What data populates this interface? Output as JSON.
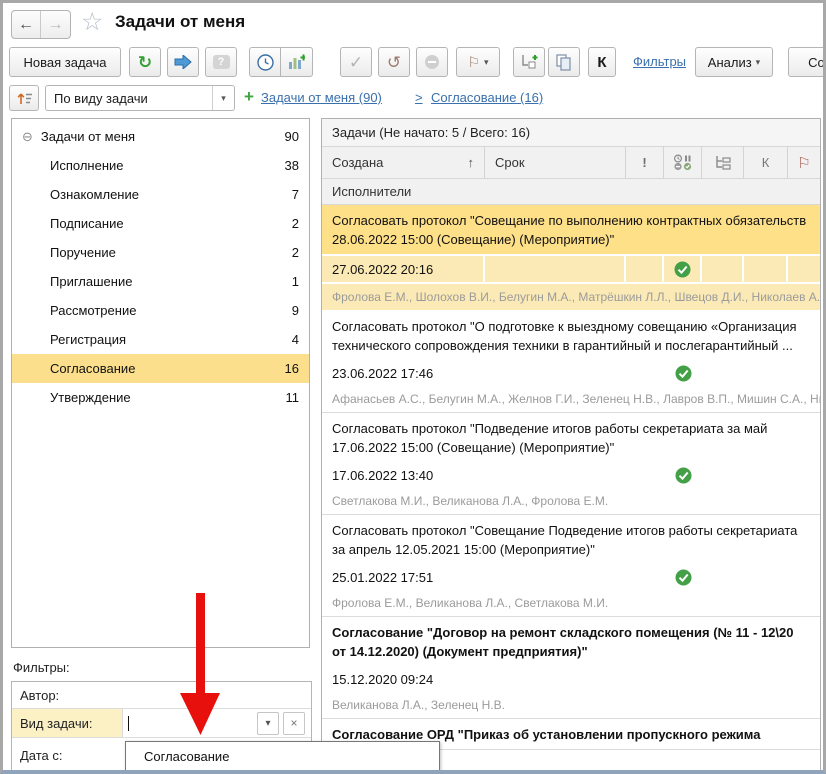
{
  "header": {
    "title": "Задачи от меня"
  },
  "toolbar": {
    "new_task": "Новая задача",
    "k_label": "К",
    "filters_link": "Фильтры",
    "analysis_label": "Анализ",
    "create_label": "Созд",
    "icons": [
      "refresh-icon",
      "forward-arrow-icon",
      "question-bubble-icon",
      "clock-icon",
      "chart-add-icon",
      "check-icon",
      "undo-icon",
      "stop-icon",
      "flag-icon",
      "tree-add-icon",
      "copy-icon"
    ]
  },
  "grouping": {
    "view_by": "По виду задачи",
    "plus": "+",
    "crumb1": "Задачи от меня (90)",
    "crumb_sep": ">",
    "crumb2": "Согласование (16)"
  },
  "tree": {
    "root_label": "Задачи от меня",
    "root_count": "90",
    "expander": "⊖",
    "items": [
      {
        "label": "Исполнение",
        "count": "38"
      },
      {
        "label": "Ознакомление",
        "count": "7"
      },
      {
        "label": "Подписание",
        "count": "2"
      },
      {
        "label": "Поручение",
        "count": "2"
      },
      {
        "label": "Приглашение",
        "count": "1"
      },
      {
        "label": "Рассмотрение",
        "count": "9"
      },
      {
        "label": "Регистрация",
        "count": "4"
      },
      {
        "label": "Согласование",
        "count": "16"
      },
      {
        "label": "Утверждение",
        "count": "11"
      }
    ]
  },
  "list": {
    "caption": "Задачи (Не начато: 5 / Всего: 16)",
    "col_created": "Создана",
    "sort_arrow": "↑",
    "col_deadline": "Срок",
    "col_priority": "!",
    "col_k": "К",
    "subheader": "Исполнители",
    "tasks": [
      {
        "title": "Согласовать протокол \"Совещание по выполнению контрактных обязательств 28.06.2022 15:00 (Совещание) (Мероприятие)\"",
        "created": "27.06.2022 20:16",
        "executors": "Фролова Е.М., Шолохов В.И., Белугин М.А., Матрёшкин Л.Л., Швецов Д.И., Николаев А.В., Н..."
      },
      {
        "title": "Согласовать протокол \"О подготовке к выездному совещанию «Организация технического сопровождения техники в гарантийный и послегарантийный ...",
        "created": "23.06.2022 17:46",
        "executors": "Афанасьев А.С., Белугин М.А., Желнов Г.И., Зеленец Н.В., Лавров В.П., Мишин С.А., Никиф..."
      },
      {
        "title": "Согласовать протокол \"Подведение итогов работы секретариата за май 17.06.2022 15:00 (Совещание) (Мероприятие)\"",
        "created": "17.06.2022 13:40",
        "executors": "Светлакова М.И., Великанова Л.А., Фролова Е.М."
      },
      {
        "title": "Согласовать протокол \"Совещание Подведение итогов работы секретариата за апрель 12.05.2021 15:00 (Мероприятие)\"",
        "created": "25.01.2022 17:51",
        "executors": "Фролова Е.М., Великанова Л.А., Светлакова М.И."
      },
      {
        "title": "Согласование \"Договор на ремонт складского помещения (№ 11 - 12\\20 от 14.12.2020) (Документ предприятия)\"",
        "created": "15.12.2020 09:24",
        "executors": "Великанова Л.А., Зеленец Н.В."
      },
      {
        "title": "Согласование ОРД \"Приказ об установлении пропускного режима"
      }
    ]
  },
  "filters": {
    "caption": "Фильтры:",
    "author_label": "Автор:",
    "kind_label": "Вид задачи:",
    "date_from_label": "Дата с:"
  },
  "popup": {
    "item": "Согласование"
  },
  "colors": {
    "selection_yellow": "#fee089",
    "selection_yellow_light": "#fbeab5",
    "link_blue": "#3a70ad",
    "check_green": "#43a047",
    "arrow_red": "#e8100c"
  }
}
